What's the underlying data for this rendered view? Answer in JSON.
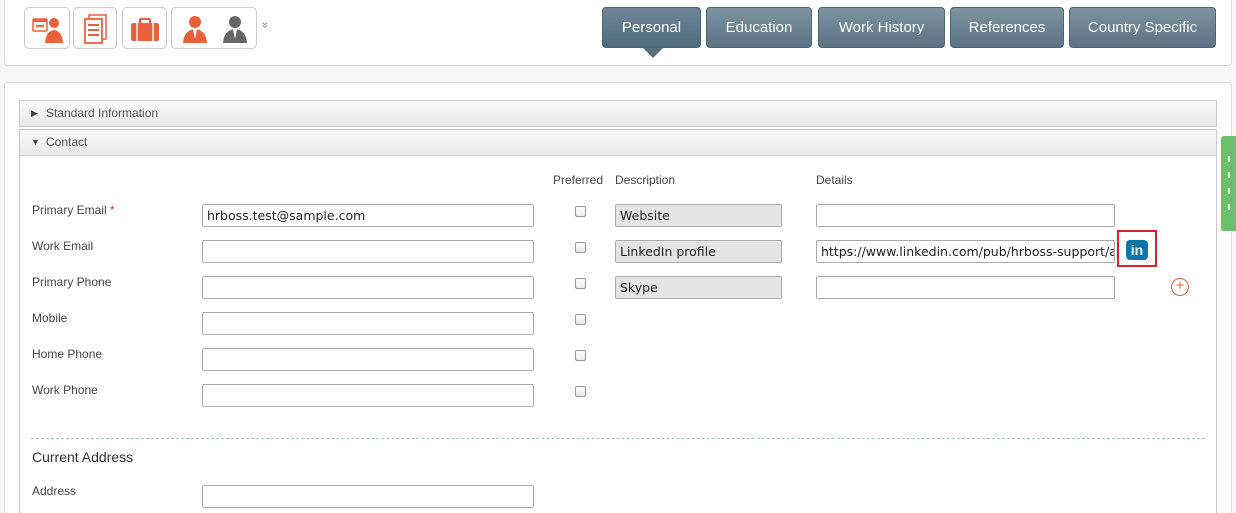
{
  "toolbar": {
    "icons": [
      "profile-card-icon",
      "document-icon",
      "briefcase-icon",
      "person-orange-icon",
      "person-gray-icon"
    ],
    "more_glyph": "»"
  },
  "tabs": [
    {
      "label": "Personal",
      "active": true
    },
    {
      "label": "Education",
      "active": false
    },
    {
      "label": "Work History",
      "active": false
    },
    {
      "label": "References",
      "active": false
    },
    {
      "label": "Country Specific",
      "active": false
    }
  ],
  "sections": {
    "standard": "Standard Information",
    "contact": "Contact"
  },
  "columns": {
    "preferred": "Preferred",
    "description": "Description",
    "details": "Details"
  },
  "contact_fields": [
    {
      "label": "Primary Email",
      "required": "*",
      "value": "hrboss.test@sample.com"
    },
    {
      "label": "Work Email",
      "value": ""
    },
    {
      "label": "Primary Phone",
      "value": ""
    },
    {
      "label": "Mobile",
      "value": ""
    },
    {
      "label": "Home Phone",
      "value": ""
    },
    {
      "label": "Work Phone",
      "value": ""
    }
  ],
  "links": [
    {
      "description": "Website",
      "details": ""
    },
    {
      "description": "LinkedIn profile",
      "details": "https://www.linkedin.com/pub/hrboss-support/a"
    },
    {
      "description": "Skype",
      "details": ""
    }
  ],
  "linkedin_glyph": "in",
  "add_glyph": "+",
  "address": {
    "heading": "Current Address",
    "label": "Address",
    "value": ""
  },
  "colors": {
    "accent_orange": "#e8603c",
    "tab_blue": "#5a7282",
    "linkedin_blue": "#0e76a8",
    "highlight_red": "#d9232e"
  }
}
